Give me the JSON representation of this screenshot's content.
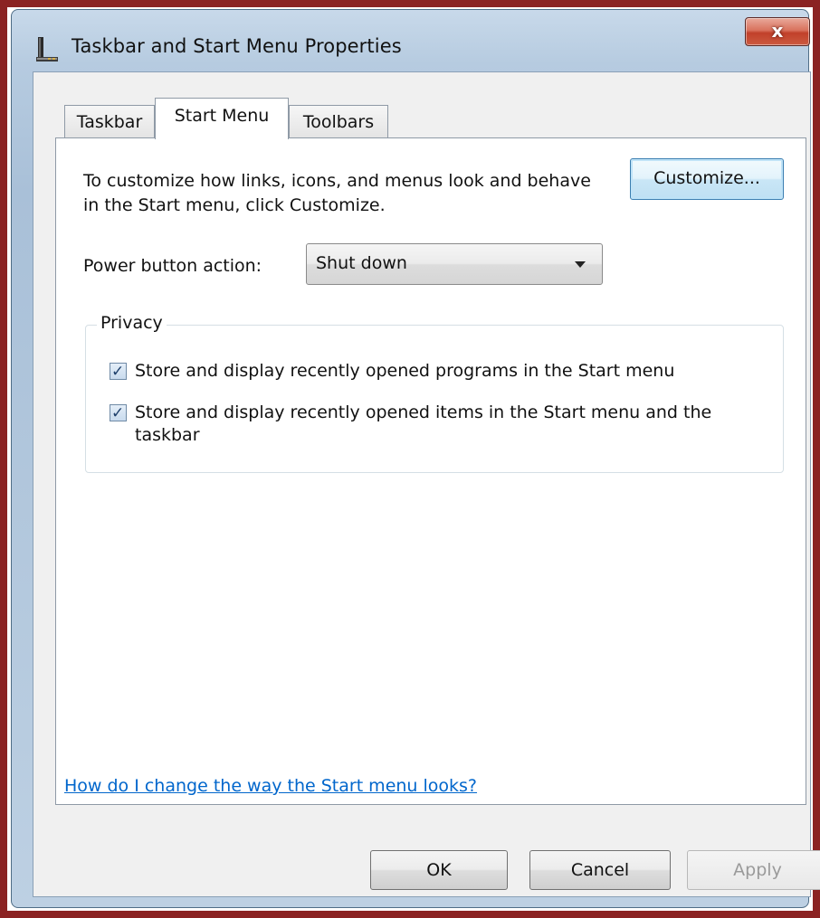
{
  "window": {
    "title": "Taskbar and Start Menu Properties",
    "close_glyph": "x"
  },
  "tabs": [
    {
      "label": "Taskbar",
      "selected": false
    },
    {
      "label": "Start Menu",
      "selected": true
    },
    {
      "label": "Toolbars",
      "selected": false
    }
  ],
  "start_menu": {
    "description": "To customize how links, icons, and menus look and behave in the Start menu, click Customize.",
    "customize_label": "Customize...",
    "power_label": "Power button action:",
    "power_value": "Shut down",
    "privacy": {
      "legend": "Privacy",
      "items": [
        {
          "label": "Store and display recently opened programs in the Start menu",
          "checked": true
        },
        {
          "label": "Store and display recently opened items in the Start menu and the taskbar",
          "checked": true
        }
      ]
    },
    "help_link": "How do I change the way the Start menu looks?"
  },
  "buttons": {
    "ok": "OK",
    "cancel": "Cancel",
    "apply": "Apply",
    "apply_enabled": false
  },
  "colors": {
    "frame_border": "#8b2323",
    "link": "#0066cc"
  }
}
